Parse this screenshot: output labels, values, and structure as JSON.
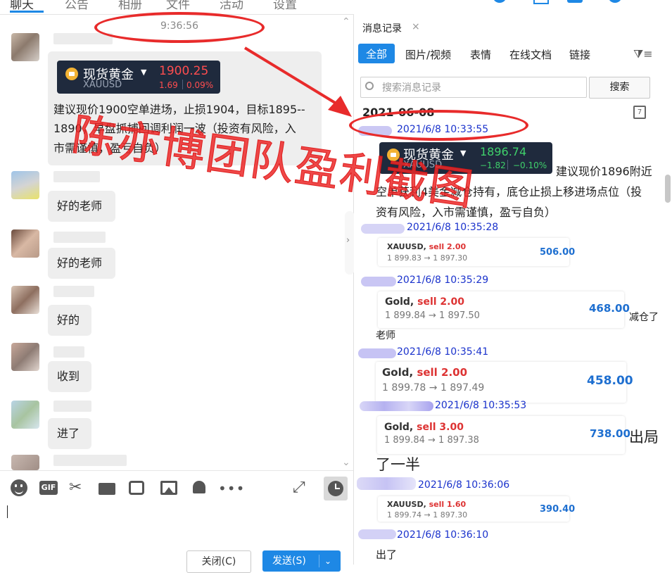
{
  "top_tabs": [
    "聊天",
    "公告",
    "相册",
    "文件",
    "活动",
    "设置"
  ],
  "left": {
    "timestamp": "9:36:56",
    "stock_card": {
      "name": "现货黄金",
      "symbol": "XAUUSD",
      "price": "1900.25",
      "change": "1.69",
      "change_pct": "0.09%",
      "color": "#ff4d4f"
    },
    "first_message": [
      "建议现价1900空单进场，止损1904，目标1895--",
      "1890，早盘抓捕回调利润一波（投资有风险，入",
      "市需谨慎，盈亏自负）"
    ],
    "replies": [
      "好的老师",
      "好的老师",
      "好的",
      "收到",
      "进了"
    ],
    "watermark": "陈亦博团队盈利截图",
    "toolbar_icons": [
      "emoji-icon",
      "gif-icon",
      "scissors-icon",
      "folder-icon",
      "shake-icon",
      "image-icon",
      "bell-icon",
      "more-icon"
    ],
    "gif_label": "GIF",
    "close_button": "关闭(C)",
    "send_button": "发送(S)"
  },
  "right": {
    "panel_title": "消息记录",
    "filter_tabs": [
      "全部",
      "图片/视频",
      "表情",
      "在线文档",
      "链接"
    ],
    "search_placeholder": "搜索消息记录",
    "search_button": "搜索",
    "date_header": "2021-06-08",
    "calendar_day": "7",
    "entries": [
      {
        "time": "2021/6/8 10:33:55"
      },
      {
        "time": "2021/6/8 10:35:28"
      },
      {
        "time": "2021/6/8 10:35:29"
      },
      {
        "time": "2021/6/8 10:35:41"
      },
      {
        "time": "2021/6/8 10:35:53"
      },
      {
        "time": "2021/6/8 10:36:06"
      },
      {
        "time": "2021/6/8 10:36:10"
      }
    ],
    "stock_card": {
      "name": "现货黄金",
      "symbol": "XAUUSD",
      "price": "1896.74",
      "change": "−1.82",
      "change_pct": "−0.10%",
      "color": "#3fd06b"
    },
    "entry1_text": [
      "建议现价1896附近",
      "空单获利4美金减仓持有，底仓止损上移进场点位（投",
      "资有风险，入市需谨慎，盈亏自负）"
    ],
    "trades": [
      {
        "symbol": "XAUUSD,",
        "side": "sell 2.00",
        "prices": "1 899.83 → 1 897.30",
        "pnl": "506.00"
      },
      {
        "symbol": "Gold,",
        "side": "sell 2.00",
        "prices": "1 899.84 → 1 897.50",
        "pnl": "468.00"
      },
      {
        "symbol": "Gold,",
        "side": "sell 2.00",
        "prices": "1 899.78 → 1 897.49",
        "pnl": "458.00"
      },
      {
        "symbol": "Gold,",
        "side": "sell 3.00",
        "prices": "1 899.84 → 1 897.38",
        "pnl": "738.00"
      },
      {
        "symbol": "XAUUSD,",
        "side": "sell 1.60",
        "prices": "1 899.74 → 1 897.30",
        "pnl": "390.40"
      }
    ],
    "note_reduce": "减仓了",
    "note_teacher": "老师",
    "note_out_1": "出局",
    "note_out_2": "了一半",
    "note_out_last": "出了"
  }
}
